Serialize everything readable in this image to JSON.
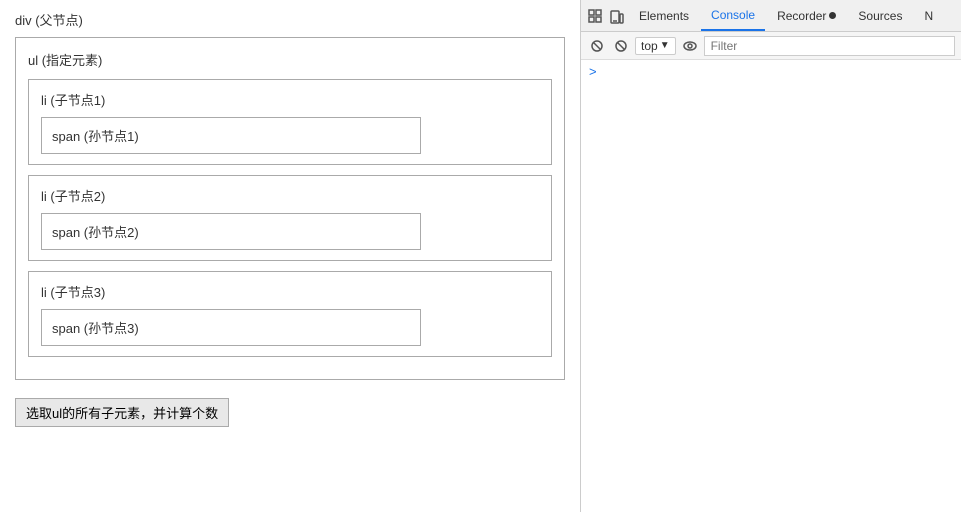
{
  "left": {
    "div_label": "div (父节点)",
    "ul_label": "ul (指定元素)",
    "li1_label": "li (子节点1)",
    "span1_label": "span (孙节点1)",
    "li2_label": "li (子节点2)",
    "span2_label": "span (孙节点2)",
    "li3_label": "li (子节点3)",
    "span3_label": "span (孙节点3)",
    "button_label": "选取ul的所有子元素，并计算个数"
  },
  "devtools": {
    "tabs": [
      "Elements",
      "Console",
      "Recorder",
      "Sources",
      "N"
    ],
    "active_tab": "Console",
    "context": "top",
    "filter_placeholder": "Filter",
    "console_arrow": ">"
  }
}
